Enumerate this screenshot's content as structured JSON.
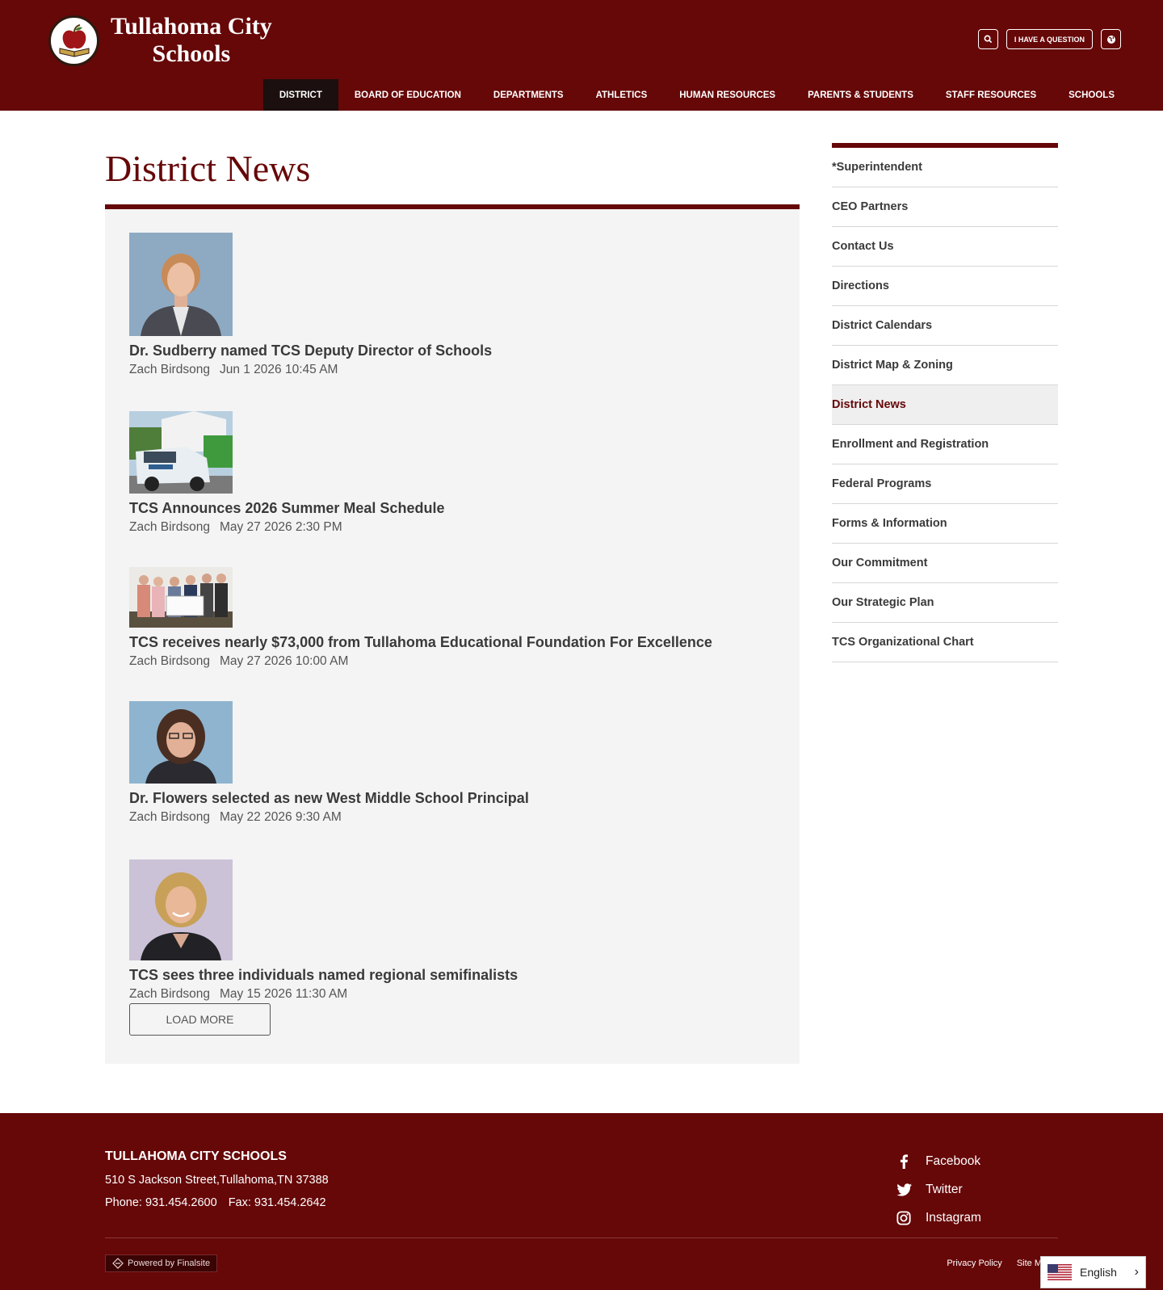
{
  "header": {
    "logo_line1": "Tullahoma City",
    "logo_line2": "Schools",
    "question_label": "I HAVE A QUESTION"
  },
  "nav": {
    "items": [
      "DISTRICT",
      "BOARD OF EDUCATION",
      "DEPARTMENTS",
      "ATHLETICS",
      "HUMAN RESOURCES",
      "PARENTS & STUDENTS",
      "STAFF RESOURCES",
      "SCHOOLS"
    ]
  },
  "main": {
    "title": "District News",
    "load_more": "LOAD MORE",
    "news": [
      {
        "title": "Dr. Sudberry named TCS Deputy Director of Schools",
        "author": "Zach Birdsong",
        "date": "Jun 1 2026 10:45 AM"
      },
      {
        "title": "TCS Announces 2026 Summer Meal Schedule",
        "author": "Zach Birdsong",
        "date": "May 27 2026 2:30 PM"
      },
      {
        "title": "TCS receives nearly $73,000 from Tullahoma Educational Foundation For Excellence",
        "author": "Zach Birdsong",
        "date": "May 27 2026 10:00 AM"
      },
      {
        "title": "Dr. Flowers selected as new West Middle School Principal",
        "author": "Zach Birdsong",
        "date": "May 22 2026 9:30 AM"
      },
      {
        "title": "TCS sees three individuals named regional semifinalists",
        "author": "Zach Birdsong",
        "date": "May 15 2026 11:30 AM"
      }
    ]
  },
  "sidebar": {
    "items": [
      "*Superintendent",
      "CEO Partners",
      "Contact Us",
      "Directions",
      "District Calendars",
      "District Map & Zoning",
      "District News",
      "Enrollment and Registration",
      "Federal Programs",
      "Forms & Information",
      "Our Commitment",
      "Our Strategic Plan",
      "TCS Organizational Chart"
    ]
  },
  "footer": {
    "name": "TULLAHOMA CITY SCHOOLS",
    "address": "510 S Jackson Street,Tullahoma,TN 37388",
    "phone": "Phone: 931.454.2600",
    "fax": "Fax: 931.454.2642",
    "social": [
      "Facebook",
      "Twitter",
      "Instagram"
    ],
    "powered": "Powered by Finalsite",
    "privacy": "Privacy Policy",
    "sitemap": "Site M",
    "language": "English"
  },
  "colors": {
    "brand": "#660708",
    "nav_active": "#1b0f0f",
    "panel": "#f4f4f4"
  },
  "icons": [
    "search-icon",
    "globe-icon",
    "facebook-icon",
    "twitter-icon",
    "instagram-icon",
    "chevron-right-icon",
    "us-flag-icon",
    "finalsite-icon"
  ]
}
